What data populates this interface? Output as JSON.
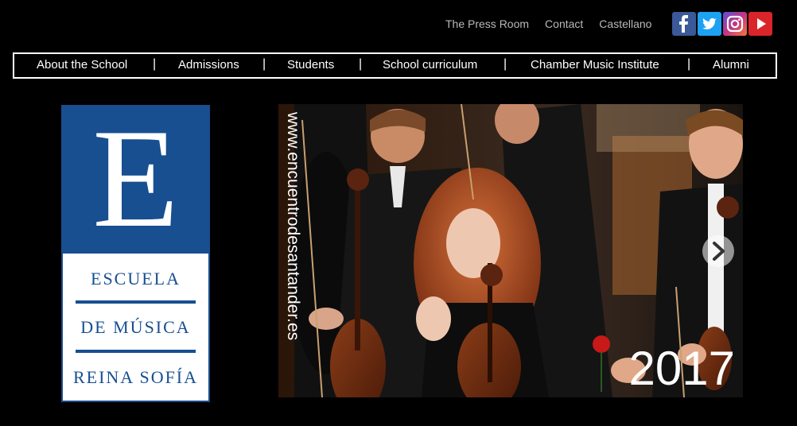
{
  "top_links": [
    "The Press Room",
    "Contact",
    "Castellano"
  ],
  "social": [
    {
      "name": "facebook-icon",
      "glyph": "f",
      "color": "#3b5998"
    },
    {
      "name": "twitter-icon",
      "glyph": "t",
      "color": "#1da1f2"
    },
    {
      "name": "instagram-icon",
      "glyph": "◎",
      "color": "#c13584"
    },
    {
      "name": "youtube-icon",
      "glyph": "▶",
      "color": "#d9252a"
    }
  ],
  "nav": {
    "items": [
      "About the School",
      "Admissions",
      "Students",
      "School curriculum",
      "Chamber Music Institute",
      "Alumni"
    ],
    "separator": "|"
  },
  "logo": {
    "letter": "E",
    "line1": "ESCUELA",
    "line2": "DE MÚSICA",
    "line3": "REINA SOFÍA",
    "brand_color": "#174f91"
  },
  "hero": {
    "vertical_text": "www.encuentrodesantander.es",
    "year": "2017"
  }
}
